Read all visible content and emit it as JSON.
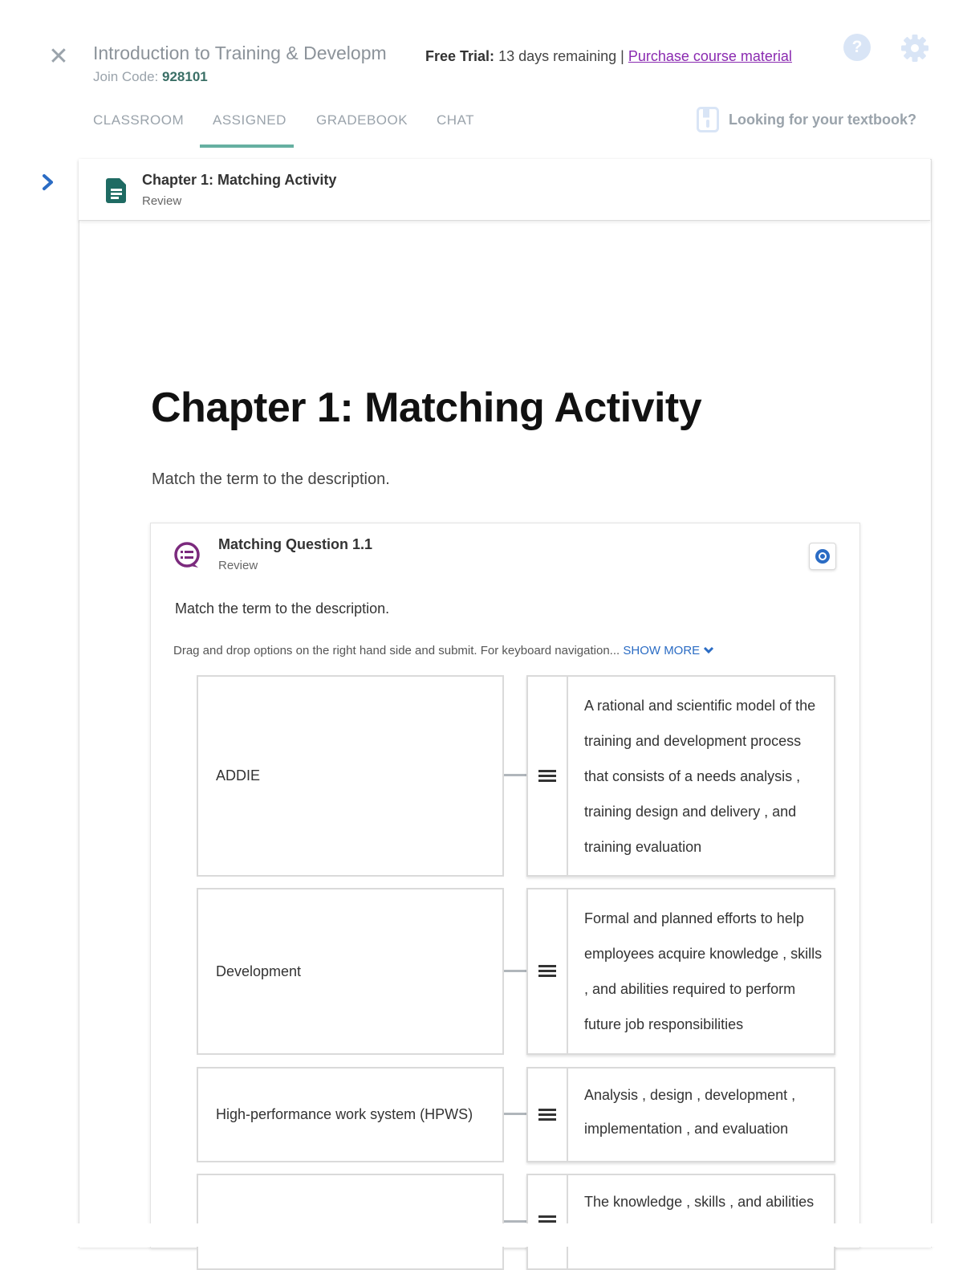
{
  "header": {
    "course_title": "Introduction to Training & Developm",
    "join_code_label": "Join Code:",
    "join_code_value": "928101",
    "trial_label": "Free Trial:",
    "trial_text": "13 days remaining |",
    "purchase_link": "Purchase course material",
    "help_icon": "?"
  },
  "tabs": [
    {
      "label": "CLASSROOM",
      "active": false
    },
    {
      "label": "ASSIGNED",
      "active": true
    },
    {
      "label": "GRADEBOOK",
      "active": false
    },
    {
      "label": "CHAT",
      "active": false
    }
  ],
  "textbook_link": "Looking for your textbook?",
  "assignment": {
    "title": "Chapter 1: Matching Activity",
    "type": "Review"
  },
  "page": {
    "title": "Chapter 1: Matching Activity",
    "subtitle": "Match the term to the description."
  },
  "question": {
    "title": "Matching Question 1.1",
    "type": "Review",
    "prompt": "Match the term to the description.",
    "instructions": "Drag and drop options on the right hand side and submit. For keyboard navigation...",
    "show_more": "SHOW MORE",
    "pairs": [
      {
        "term": "ADDIE",
        "description": "A rational and scientific model of the training and development process that consists of a needs analysis , training design and delivery , and training evaluation"
      },
      {
        "term": "Development",
        "description": "Formal and planned efforts to help employees acquire knowledge , skills , and abilities required to perform future job responsibilities"
      },
      {
        "term": "High-performance work system (HPWS)",
        "description": "Analysis , design , development , implementation , and evaluation"
      },
      {
        "term": "",
        "description": "The knowledge , skills , and abilities"
      }
    ]
  },
  "colors": {
    "accent": "#66b0a1",
    "link": "#8a2ab0",
    "show_more": "#2b6cc4",
    "question_icon": "#7b2a7d",
    "doc_icon": "#1f6b63"
  }
}
